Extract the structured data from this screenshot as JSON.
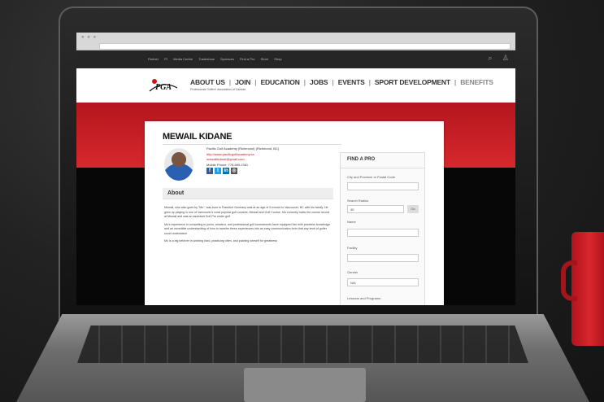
{
  "browser": {
    "window_dots": "● ● ●"
  },
  "topnav": {
    "links": [
      "Partner",
      "PI",
      "Media Centre",
      "Tradeshow",
      "Sponsors",
      "Find a Pro",
      "Store",
      "Shop"
    ],
    "search_icon": "search-icon",
    "user_icon": "user-icon"
  },
  "header": {
    "logo_text": "PGA",
    "tagline": "Professional Golfers' Association of Canada",
    "nav": [
      "ABOUT US",
      "JOIN",
      "EDUCATION",
      "JOBS",
      "EVENTS",
      "SPORT DEVELOPMENT",
      "BENEFITS"
    ]
  },
  "profile": {
    "name": "MEWAIL KIDANE",
    "facility": "Pacific Golf Academy (Richmond) (Richmond, BC)",
    "website": "http://www.pacificgolfacademy.ca",
    "email": "mewailkidane@gmail.com",
    "phone": "Mobile Phone: 778.899.2361",
    "social": [
      "f",
      "t",
      "in",
      "◎"
    ]
  },
  "about": {
    "heading": "About",
    "paragraphs": [
      "Mewail, who also goes by \"Mo\", was born in Frankfurt Germany was at an age of 5 moved to Vancouver, BC with his family. He grew up playing in one of Vancouver's most popular golf courses, Mewail and Golf Course. Mo currently holds the course record at Mewail and was an assistant Golf Pro under golf.",
      "Mo's experience in competing in junior, amateur, and professional golf tournaments have equipped him with priceless knowledge and an incredible understanding of how to transfer these experiences into an easy communication form that any level of golfer could understand.",
      "Mo is a big believer in working hard, practicing often, and pushing oneself for greatness"
    ]
  },
  "sidebar": {
    "title": "FIND A PRO",
    "city_placeholder": "City and Province or Postal Code",
    "radius_label": "Search Radius",
    "radius_value": "40",
    "go_label": "Go",
    "name_label": "Name",
    "facility_label": "Facility",
    "gender_label": "Gender",
    "gender_value": "N/A",
    "lessons_label": "Lessons and Programs"
  },
  "colors": {
    "brand_red": "#c8171f",
    "dark": "#262626"
  }
}
